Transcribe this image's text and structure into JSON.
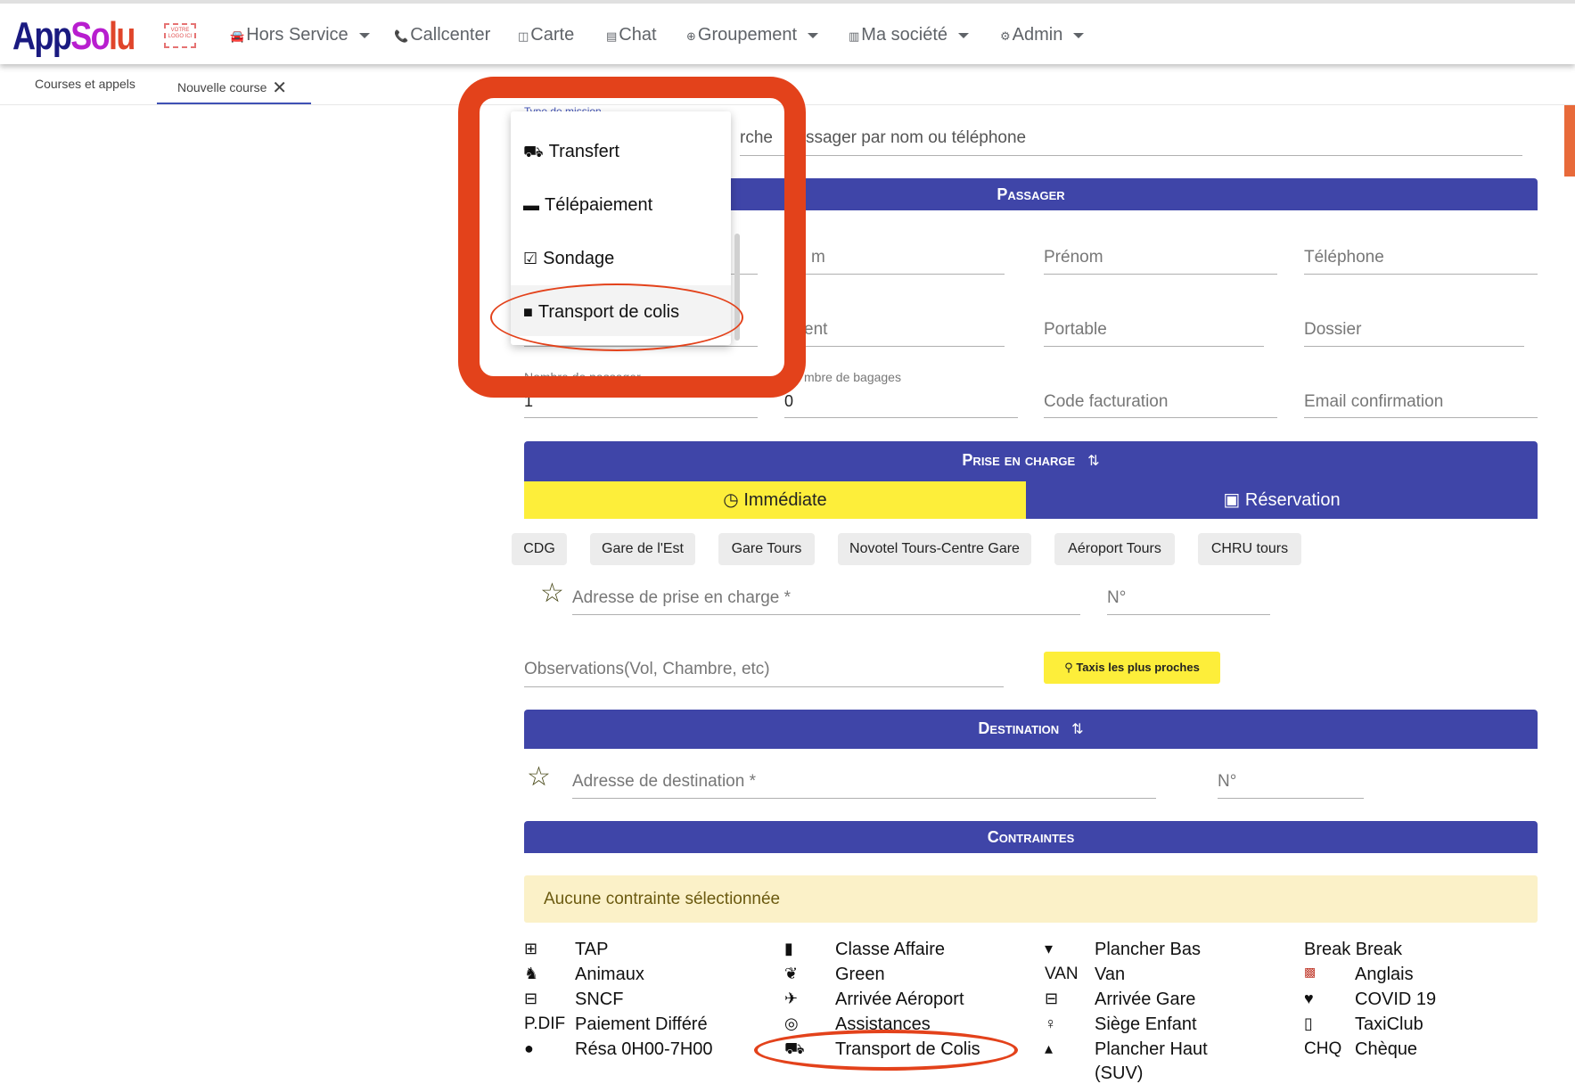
{
  "app": {
    "brand_a": "App",
    "brand_b": "So",
    "brand_c": "lu",
    "logo_badge": "VOTRE LOGO ICI"
  },
  "nav": {
    "hors_service": "Hors Service",
    "callcenter": "Callcenter",
    "carte": "Carte",
    "chat": "Chat",
    "groupement": "Groupement",
    "ma_societe": "Ma société",
    "admin": "Admin"
  },
  "tabs": {
    "courses": "Courses et appels",
    "nouvelle": "Nouvelle course"
  },
  "search": {
    "placeholder_partial": "rche",
    "placeholder_rest": "passager par nom ou téléphone",
    "mission_label_partial": "Type de mission"
  },
  "passager": {
    "header": "Passager",
    "nom_partial": "m",
    "prenom": "Prénom",
    "telephone": "Téléphone",
    "client_partial": "ent",
    "portable": "Portable",
    "dossier": "Dossier",
    "nb_passager_label": "Nombre de passager",
    "nb_passager_value": "1",
    "nb_bagages_label": "mbre de bagages",
    "nb_bagages_value": "0",
    "code_facturation": "Code facturation",
    "email_confirmation": "Email confirmation"
  },
  "prise_en_charge": {
    "header": "Prise en charge",
    "immediate": "Immédiate",
    "reservation": "Réservation",
    "chips": [
      "CDG",
      "Gare de l'Est",
      "Gare Tours",
      "Novotel Tours-Centre Gare",
      "Aéroport Tours",
      "CHRU tours"
    ],
    "adresse": "Adresse de prise en charge *",
    "numero": "N°",
    "observations": "Observations(Vol, Chambre, etc)",
    "nearest_btn": "Taxis les plus proches"
  },
  "destination": {
    "header": "Destination",
    "adresse": "Adresse de destination *",
    "numero": "N°"
  },
  "contraintes": {
    "header": "Contraintes",
    "notice": "Aucune contrainte sélectionnée",
    "col1": [
      {
        "icon": "medkit-icon",
        "label": "TAP"
      },
      {
        "icon": "dog-icon",
        "label": "Animaux"
      },
      {
        "icon": "train-icon",
        "label": "SNCF"
      },
      {
        "icon": "text-P.DIF",
        "label": "Paiement Différé"
      },
      {
        "icon": "clock-icon",
        "label": "Résa 0H00-7H00"
      }
    ],
    "col2": [
      {
        "icon": "suitcase-icon",
        "label": "Classe Affaire"
      },
      {
        "icon": "leaf-icon",
        "label": "Green"
      },
      {
        "icon": "plane-icon",
        "label": "Arrivée Aéroport"
      },
      {
        "icon": "lifebuoy-icon",
        "label": "Assistances"
      },
      {
        "icon": "truck-icon",
        "label": "Transport de Colis"
      }
    ],
    "col3": [
      {
        "icon": "caret-down-icon",
        "label": "Plancher Bas"
      },
      {
        "icon": "text-VAN",
        "label": "Van"
      },
      {
        "icon": "train-icon",
        "label": "Arrivée Gare"
      },
      {
        "icon": "child-icon",
        "label": "Siège Enfant"
      },
      {
        "icon": "caret-up-icon",
        "label": "Plancher Haut"
      },
      {
        "icon": "",
        "label": "(SUV)"
      }
    ],
    "col4": [
      {
        "icon": "",
        "label": "Break Break"
      },
      {
        "icon": "uk-flag-icon",
        "label": "Anglais"
      },
      {
        "icon": "heartbeat-icon",
        "label": "COVID 19"
      },
      {
        "icon": "mobile-icon",
        "label": "TaxiClub"
      },
      {
        "icon": "text-CHQ",
        "label": "Chèque"
      }
    ],
    "text_icons": {
      "pdif": "P.DIF",
      "van": "VAN",
      "chq": "CHQ"
    }
  },
  "dropdown": {
    "items": [
      "Transfert",
      "Télépaiement",
      "Sondage",
      "Transport de colis"
    ]
  },
  "colors": {
    "primary": "#3f45a8",
    "accent_yellow": "#fdee3a",
    "annotation": "#e3421b",
    "notice_bg": "#fbf1c8"
  }
}
